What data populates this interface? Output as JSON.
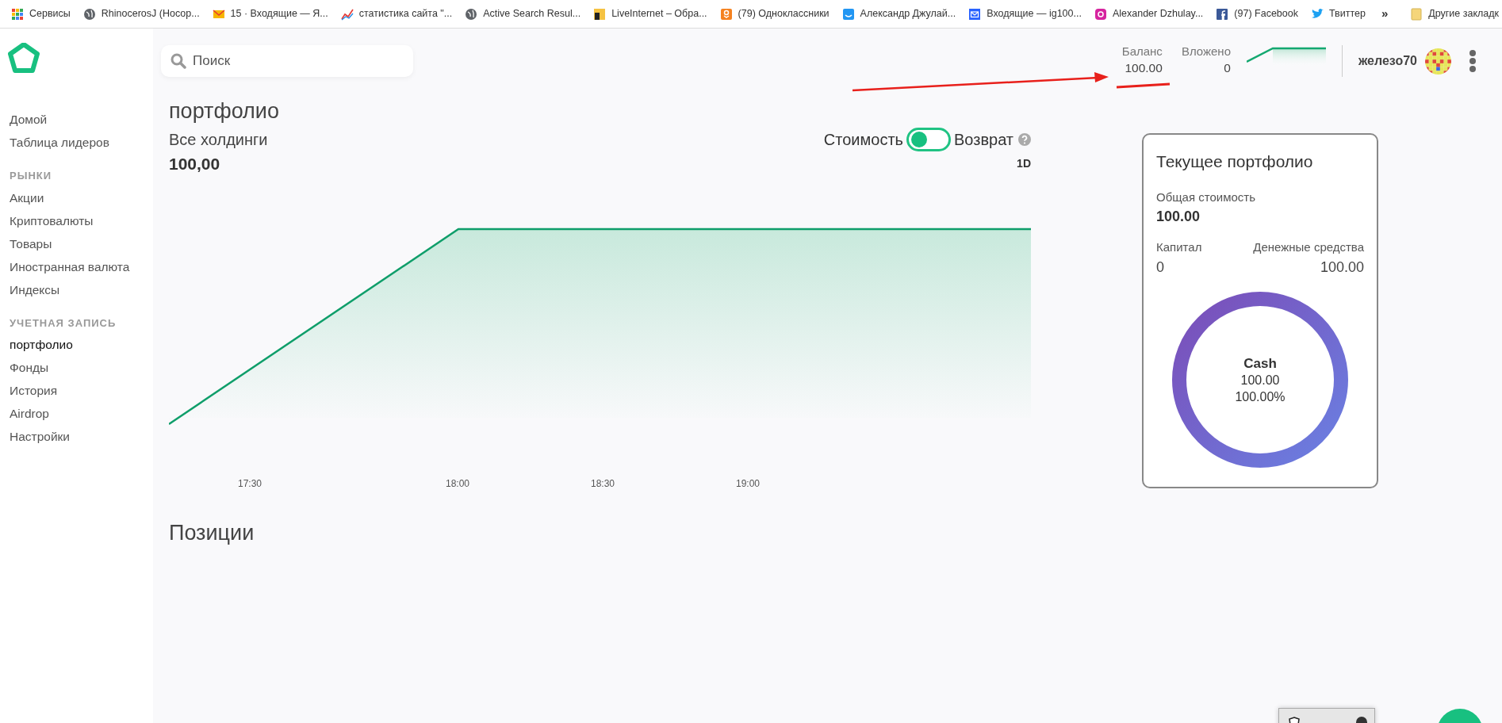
{
  "bookmarks": [
    {
      "kind": "apps",
      "label": "Сервисы"
    },
    {
      "kind": "globe",
      "label": "RhinocerosJ (Носор..."
    },
    {
      "kind": "mail",
      "label": "15 · Входящие — Я..."
    },
    {
      "kind": "stats",
      "label": "статистика сайта \"..."
    },
    {
      "kind": "globe",
      "label": "Active Search Resul..."
    },
    {
      "kind": "li",
      "label": "LiveInternet – Обра..."
    },
    {
      "kind": "ok",
      "label": "(79) Одноклассники"
    },
    {
      "kind": "smile",
      "label": "Александр Джулай..."
    },
    {
      "kind": "envelope",
      "label": "Входящие — ig100..."
    },
    {
      "kind": "insta",
      "label": "Alexander Dzhulay..."
    },
    {
      "kind": "fb",
      "label": "(97) Facebook"
    },
    {
      "kind": "bird",
      "label": "Твиттер"
    }
  ],
  "bookmarks_overflow": "»",
  "other_bookmarks": {
    "kind": "folder",
    "label": "Другие закладк"
  },
  "sidebar": [
    {
      "items": [
        {
          "label": "Домой",
          "selected": false
        },
        {
          "label": "Таблица лидеров",
          "selected": false
        }
      ]
    },
    {
      "heading": "РЫНКИ",
      "items": [
        {
          "label": "Акции",
          "selected": false
        },
        {
          "label": "Криптовалюты",
          "selected": false
        },
        {
          "label": "Товары",
          "selected": false
        },
        {
          "label": "Иностранная валюта",
          "selected": false
        },
        {
          "label": "Индексы",
          "selected": false
        }
      ]
    },
    {
      "heading": "УЧЕТНАЯ ЗАПИСЬ",
      "items": [
        {
          "label": "портфолио",
          "selected": true
        },
        {
          "label": "Фонды",
          "selected": false
        },
        {
          "label": "История",
          "selected": false
        },
        {
          "label": "Airdrop",
          "selected": false
        },
        {
          "label": "Настройки",
          "selected": false
        }
      ]
    }
  ],
  "search": {
    "placeholder": "Поиск"
  },
  "header_stats": [
    {
      "label": "Баланс",
      "value": "100.00"
    },
    {
      "label": "Вложено",
      "value": "0"
    }
  ],
  "user": {
    "name": "железо70"
  },
  "page_title": "портфолио",
  "holdings": {
    "label": "Все холдинги",
    "value": "100,00"
  },
  "toggle": {
    "left_label": "Стоимость",
    "right_label": "Возврат",
    "on": false
  },
  "range": "1D",
  "chart_x_labels": [
    "17:30",
    "18:00",
    "18:30",
    "19:00"
  ],
  "card": {
    "title": "Текущее портфолио",
    "total_label": "Общая стоимость",
    "total_value": "100.00",
    "capital_label": "Капитал",
    "capital_value": "0",
    "cash_label": "Денежные средства",
    "cash_value": "100.00",
    "donut_name": "Cash",
    "donut_value": "100.00",
    "donut_percent": "100.00%"
  },
  "positions_title": "Позиции"
}
